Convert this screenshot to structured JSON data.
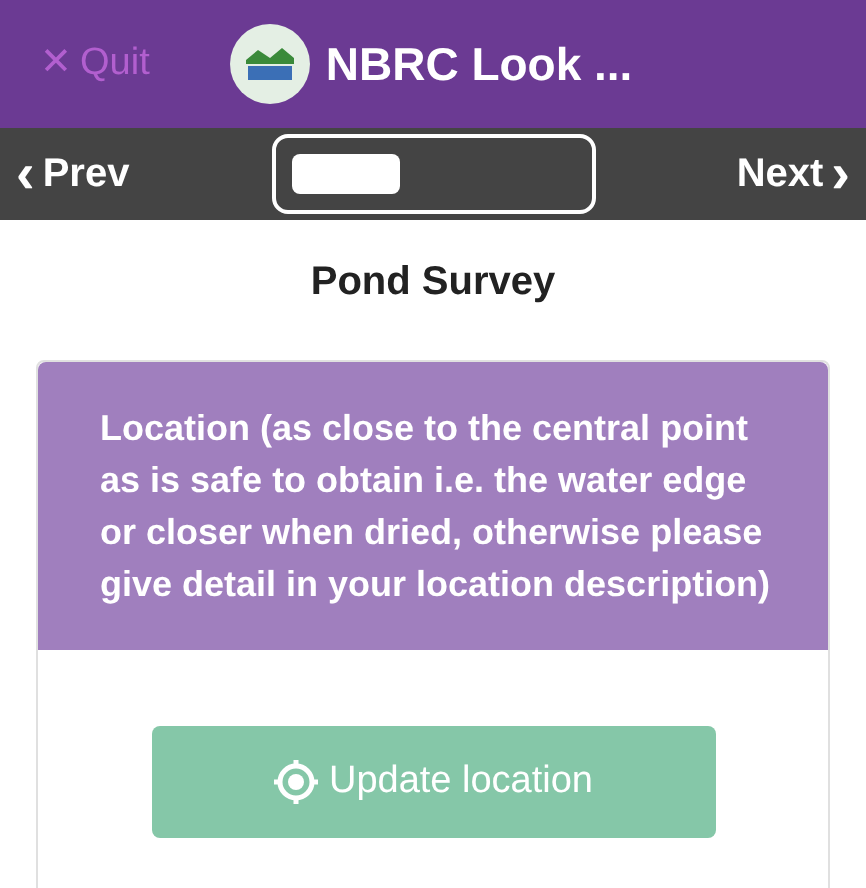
{
  "header": {
    "quit": {
      "icon": "✕",
      "label": "Quit",
      "disabled": true
    },
    "title": "NBRC Look ..."
  },
  "nav": {
    "prev": {
      "icon": "‹",
      "label": "Prev"
    },
    "next": {
      "label": "Next",
      "icon": "›"
    }
  },
  "page_title": "Pond Survey",
  "question": {
    "label": "Location (as close to the central point as is safe to obtain i.e. the water edge or closer when dried, otherwise please give detail in your location description)",
    "button": {
      "label": "Update location",
      "disabled": true
    }
  }
}
